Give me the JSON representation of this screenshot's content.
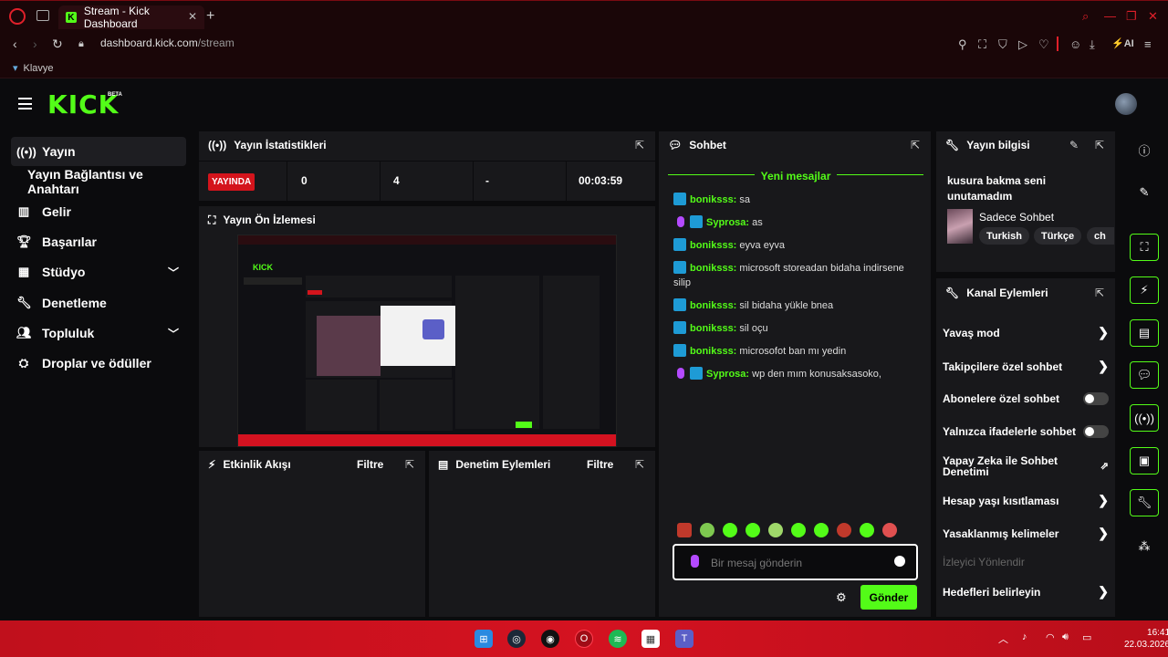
{
  "browser": {
    "tab_title": "Stream - Kick Dashboard",
    "favicon_letter": "K",
    "url_domain": "dashboard.kick.com",
    "url_path": "/stream",
    "bookmark": "Klavye"
  },
  "header": {
    "logo": "KICK",
    "beta": "BETA"
  },
  "sidebar": {
    "items": [
      {
        "label": "Yayın",
        "icon": "broadcast-icon"
      },
      {
        "label": "Yayın Bağlantısı ve Anahtarı",
        "icon": ""
      },
      {
        "label": "Gelir",
        "icon": "chart-icon"
      },
      {
        "label": "Başarılar",
        "icon": "trophy-icon"
      },
      {
        "label": "Stüdyo",
        "icon": "film-icon"
      },
      {
        "label": "Denetleme",
        "icon": "wrench-icon"
      },
      {
        "label": "Topluluk",
        "icon": "people-icon"
      },
      {
        "label": "Droplar ve ödüller",
        "icon": "gift-icon"
      }
    ]
  },
  "stats": {
    "title": "Yayın İstatistikleri",
    "live_badge": "YAYINDA",
    "viewers": "0",
    "followers": "4",
    "dash": "-",
    "duration": "00:03:59"
  },
  "preview": {
    "title": "Yayın Ön İzlemesi"
  },
  "activity": {
    "title": "Etkinlik Akışı",
    "filter": "Filtre"
  },
  "mod_actions": {
    "title": "Denetim Eylemleri",
    "filter": "Filtre"
  },
  "chat": {
    "title": "Sohbet",
    "new_messages": "Yeni mesajlar",
    "messages": [
      {
        "user": "boniksss:",
        "text": "sa",
        "mic": false
      },
      {
        "user": "Syprosa:",
        "text": "as",
        "mic": true
      },
      {
        "user": "boniksss:",
        "text": "eyva eyva",
        "mic": false
      },
      {
        "user": "boniksss:",
        "text": "microsoft storeadan bidaha indirsene silip",
        "mic": false
      },
      {
        "user": "boniksss:",
        "text": "sil bidaha yükle bnea",
        "mic": false
      },
      {
        "user": "boniksss:",
        "text": "sil oçu",
        "mic": false
      },
      {
        "user": "boniksss:",
        "text": "microsofot ban mı yedin",
        "mic": false
      },
      {
        "user": "Syprosa:",
        "text": "wp den mım konusaksasoko,",
        "mic": true
      }
    ],
    "input_placeholder": "Bir mesaj gönderin",
    "send_label": "Gönder"
  },
  "stream_info": {
    "title": "Yayın bilgisi",
    "stream_title": "kusura bakma seni unutamadım",
    "category": "Sadece Sohbet",
    "tags": [
      "Turkish",
      "Türkçe",
      "ch"
    ]
  },
  "channel_actions": {
    "title": "Kanal Eylemleri",
    "items": [
      {
        "label": "Yavaş mod",
        "type": "arrow"
      },
      {
        "label": "Takipçilere özel sohbet",
        "type": "arrow"
      },
      {
        "label": "Abonelere özel sohbet",
        "type": "toggle"
      },
      {
        "label": "Yalnızca ifadelerle sohbet",
        "type": "toggle"
      },
      {
        "label": "Yapay Zeka ile Sohbet Denetimi",
        "type": "external"
      },
      {
        "label": "Hesap yaşı kısıtlaması",
        "type": "arrow"
      },
      {
        "label": "Yasaklanmış kelimeler",
        "type": "arrow"
      },
      {
        "label": "İzleyici Yönlendir",
        "type": "disabled"
      },
      {
        "label": "Hedefleri belirleyin",
        "type": "arrow"
      }
    ]
  },
  "taskbar": {
    "time": "16:41",
    "date": "22.03.2026"
  },
  "colors": {
    "accent": "#53fc18",
    "live": "#d4141c",
    "taskbar": "#d41220",
    "mic": "#b44aff"
  }
}
